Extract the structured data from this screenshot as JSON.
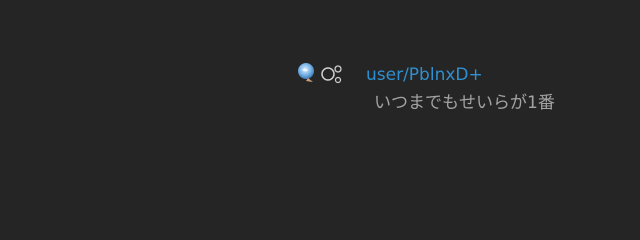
{
  "post": {
    "avatar_icon": "orb-avatar-icon",
    "bubbles_icon": "bubbles-icon",
    "username": "user/PblnxD+",
    "message": "いつまでもせいらが1番"
  },
  "colors": {
    "background": "#252525",
    "username": "#2f8fd0",
    "message": "#a3a3a3"
  }
}
